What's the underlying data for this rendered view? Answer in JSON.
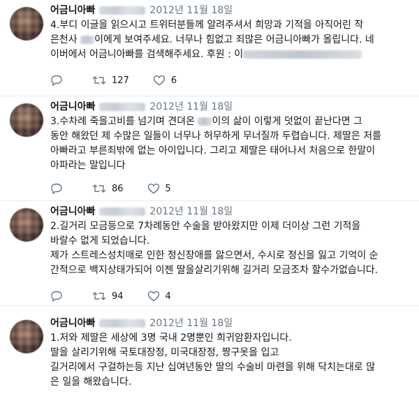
{
  "tweets": [
    {
      "name": "어금니아빠",
      "date": "2012년 11월 18일",
      "lines": [
        [
          "4.부디 이글을 읽으시고 트위터분들께 알려주셔서 희망과 기적을 아직어린 작"
        ],
        [
          "은천사 ",
          "@BLUR",
          "이에게 보여주세요. 너무나 힘없고 죄많은 어금니아빠가 올립니다. 네"
        ],
        [
          "이버에서 어금니아빠를 검색해주세요. 후원 : 이",
          "@BLURLG"
        ]
      ],
      "retweets": "127",
      "likes": "6"
    },
    {
      "name": "어금니아빠",
      "date": "2012년 11월 18일",
      "lines": [
        [
          "3.수차례 죽을고비를 넘기며 견뎌온 ",
          "@BLUR",
          "이의 삶이 이렇게 덧없이 끝난다면 그"
        ],
        [
          "동안 해왔던 제 수많은 일들이 너무나 허무하게 무너질까 두렵습니다. 제딸은 저를"
        ],
        [
          "아빠라고 부른죄밖에 없는 아이입니다. 그리고 제딸은 태어나서 처음으로 한말이"
        ],
        [
          "아파라는 말입니다"
        ]
      ],
      "retweets": "86",
      "likes": "5"
    },
    {
      "name": "어금니아빠",
      "date": "2012년 11월 18일",
      "lines": [
        [
          "2.길거리 모금등으로 7차례동안 수술을 받아왔지만 이제 더이상 그런 기적을"
        ],
        [
          "바랄수 없게 되었습니다."
        ],
        [
          "제가 스트레스성치매로 인한 정신장애를 앓으면서, 수시로 정신을 잃고 기억이 순"
        ],
        [
          "간적으로 백지상태가되어 이젠 딸을살리기위해 길거리 모금조차 할수가없습니다."
        ]
      ],
      "retweets": "94",
      "likes": "4"
    },
    {
      "name": "어금니아빠",
      "date": "2012년 11월 18일",
      "lines": [
        [
          "1.저와 제딸은 세상에 3명 국내 2명뿐인 희귀암환자입니다."
        ],
        [
          "딸을 살리기위해 국토대장정, 미국대장정, 짱구옷을 입고"
        ],
        [
          "길거리에서 구걸하는등 지난 십여년동안 딸의 수술비 마련을 위해 닥치는대로 많"
        ],
        [
          "은 일을 해왔습니다."
        ]
      ]
    }
  ],
  "icons": {
    "reply": "reply-icon",
    "retweet": "retweet-icon",
    "like": "like-icon"
  },
  "colors": {
    "text": "#14171a",
    "muted": "#657786",
    "divider": "#e6ecf0"
  }
}
